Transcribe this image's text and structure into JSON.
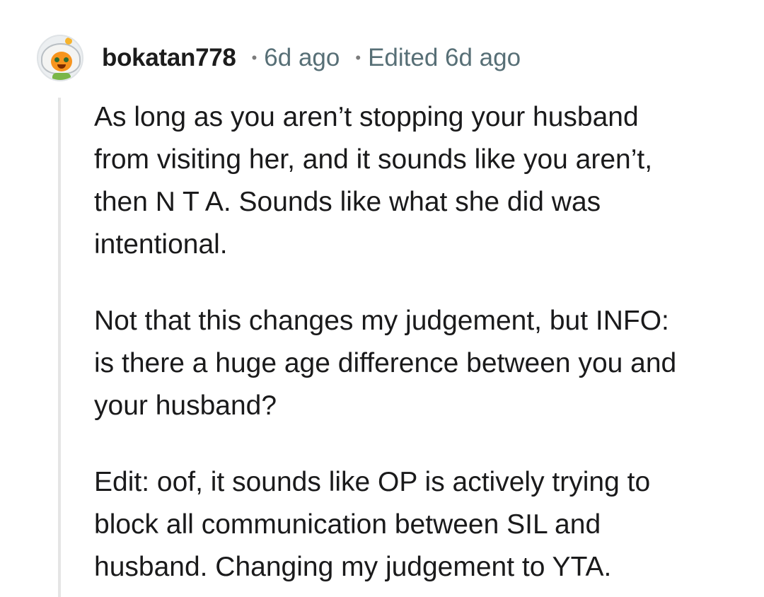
{
  "comment": {
    "author": "bokatan778",
    "separator": "•",
    "posted": "6d ago",
    "edited": "Edited 6d ago",
    "avatar_icon": "snoo-avatar-icon",
    "paragraphs": [
      {
        "lines": [
          "As long as you aren’t stopping your husband",
          "from visiting her, and it sounds like you aren’t,",
          "then N T A. Sounds like what she did was",
          "intentional."
        ]
      },
      {
        "lines": [
          "Not that this changes my judgement, but INFO:",
          "is there a huge age difference between you and",
          "your husband?"
        ]
      },
      {
        "lines": [
          "Edit: oof, it sounds like OP is actively trying to",
          "block all communication between SIL and",
          "husband. Changing my judgement to YTA."
        ]
      }
    ]
  },
  "colors": {
    "text": "#1a1a1b",
    "meta": "#576f76",
    "thread_line": "#e5e5e5"
  }
}
